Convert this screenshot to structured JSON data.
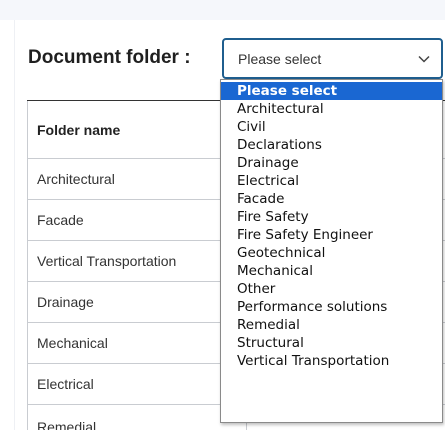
{
  "form": {
    "label": "Document folder :",
    "select_value": "Please select"
  },
  "table": {
    "header": "Folder name",
    "rows": [
      "Architectural",
      "Facade",
      "Vertical Transportation",
      "Drainage",
      "Mechanical",
      "Electrical",
      "Remedial"
    ]
  },
  "dropdown": {
    "options": [
      "Please select",
      "Architectural",
      "Civil",
      "Declarations",
      "Drainage",
      "Electrical",
      "Facade",
      "Fire Safety",
      "Fire Safety Engineer",
      "Geotechnical",
      "Mechanical",
      "Other",
      "Performance solutions",
      "Remedial",
      "Structural",
      "Vertical Transportation"
    ],
    "highlighted": "Please select"
  },
  "colors": {
    "accent": "#1a67d2",
    "select_border": "#1f5e8e"
  },
  "icons": {
    "select_chevron": "chevron-down-icon"
  }
}
